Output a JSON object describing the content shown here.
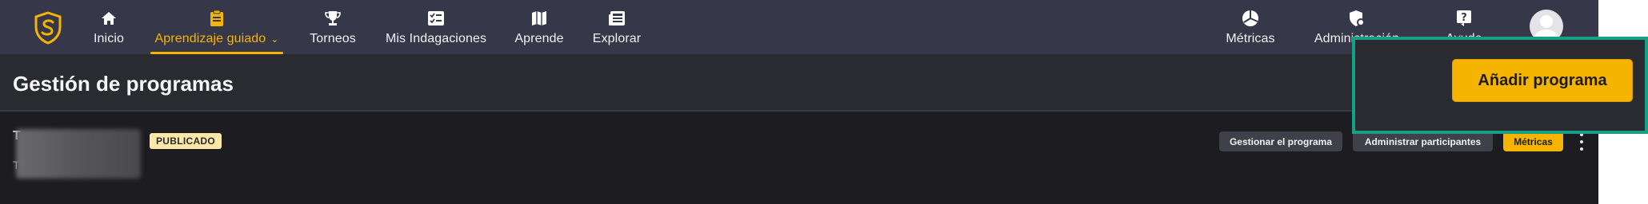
{
  "nav": {
    "items": [
      {
        "label": "Inicio",
        "icon": "home-icon"
      },
      {
        "label": "Aprendizaje guiado",
        "icon": "clipboard-icon",
        "active": true
      },
      {
        "label": "Torneos",
        "icon": "trophy-icon"
      },
      {
        "label": "Mis Indagaciones",
        "icon": "checklist-icon"
      },
      {
        "label": "Aprende",
        "icon": "map-icon"
      },
      {
        "label": "Explorar",
        "icon": "newspaper-icon"
      }
    ],
    "right_items": [
      {
        "label": "Métricas",
        "icon": "pie-chart-icon"
      },
      {
        "label": "Administración",
        "icon": "shield-gear-icon"
      },
      {
        "label": "Ayuda",
        "icon": "help-icon"
      }
    ],
    "accent_color": "#f5b400"
  },
  "header": {
    "title": "Gestión de programas",
    "add_button": "Añadir programa"
  },
  "program": {
    "name": "T",
    "description": "T",
    "status": "PUBLICADO",
    "actions": {
      "manage": "Gestionar el programa",
      "participants": "Administrar participantes",
      "metrics": "Métricas"
    }
  }
}
